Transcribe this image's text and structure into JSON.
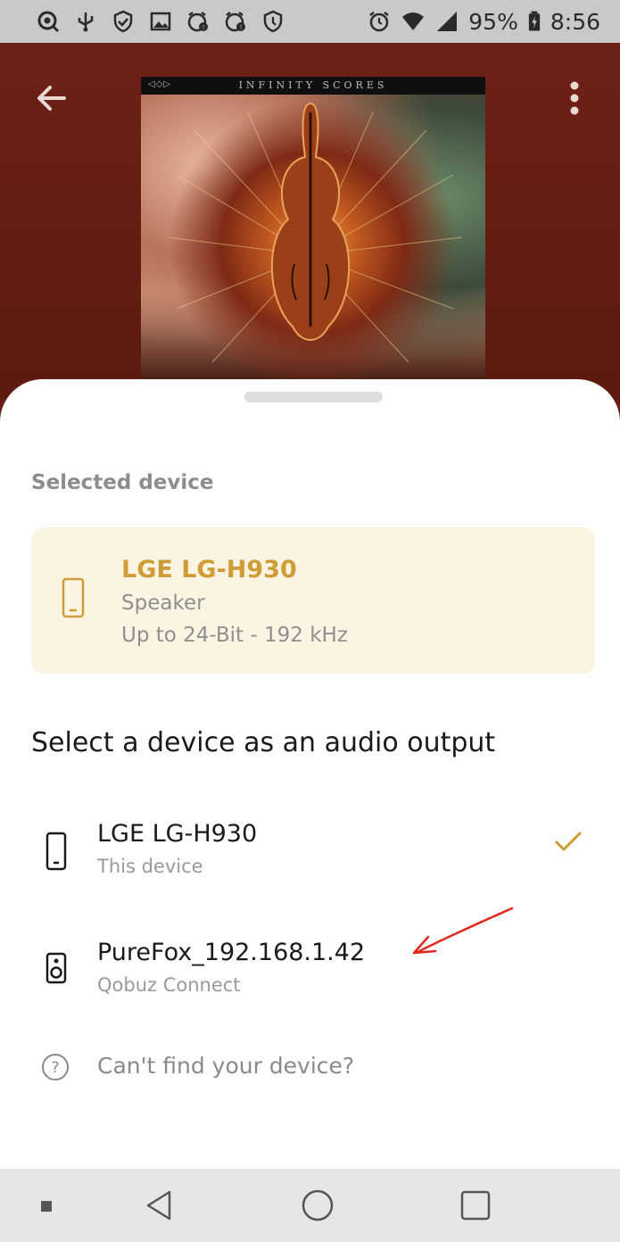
{
  "status_bar": {
    "battery": "95%",
    "time": "8:56",
    "left_icons": [
      "search-circle-icon",
      "usb-icon",
      "shield-check-icon",
      "image-icon",
      "alarm-alert-icon",
      "alarm-alert-icon",
      "shield-icon"
    ],
    "right_icons": [
      "alarm-icon",
      "wifi-icon",
      "cellular-signal-icon",
      "battery-icon"
    ]
  },
  "player": {
    "cover_title": "INFINITY SCORES",
    "cover_logo": "◁◇▷"
  },
  "sheet": {
    "section_label": "Selected device",
    "selected_device": {
      "name": "LGE LG-H930",
      "type": "Speaker",
      "quality": "Up to 24-Bit - 192 kHz"
    },
    "heading": "Select a device as an audio output",
    "devices": [
      {
        "title": "LGE LG-H930",
        "subtitle": "This device",
        "selected": true,
        "icon": "phone-icon"
      },
      {
        "title": "PureFox_192.168.1.42",
        "subtitle": "Qobuz Connect",
        "selected": false,
        "icon": "speaker-icon"
      }
    ],
    "help": "Can't find your device?"
  },
  "colors": {
    "accent": "#cf9d37",
    "card_bg": "#fbf4e2",
    "player_bg": "#6b1f14",
    "annotation": "#e02a1f"
  }
}
